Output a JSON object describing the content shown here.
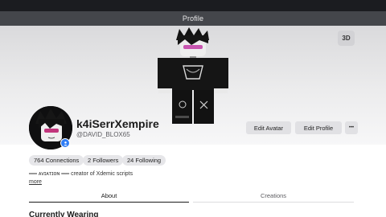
{
  "header": {
    "title": "Profile"
  },
  "banner": {
    "view_3d_label": "3D"
  },
  "profile": {
    "display_name": "k4iSerrXempire",
    "username": "@DAVID_BLOX65",
    "connections_label": "764 Connections",
    "followers_label": "2 Followers",
    "following_label": "24 Following",
    "bio": "══ ᴀᴠɪᴀᴛɪᴏɴ ══ creator of Xdemic scripts",
    "more_label": "more"
  },
  "actions": {
    "edit_avatar_label": "Edit Avatar",
    "edit_profile_label": "Edit Profile",
    "more_options_label": "•••"
  },
  "tabs": [
    {
      "label": "About"
    },
    {
      "label": "Creations"
    }
  ],
  "sections": {
    "currently_wearing": "Currently Wearing"
  },
  "icons": {
    "verified_badge": "verified-badge-icon",
    "more_options": "ellipsis-icon"
  },
  "colors": {
    "header_bg": "#44464b",
    "badge_blue": "#2f7df6",
    "button_bg": "#e1e1e4"
  }
}
